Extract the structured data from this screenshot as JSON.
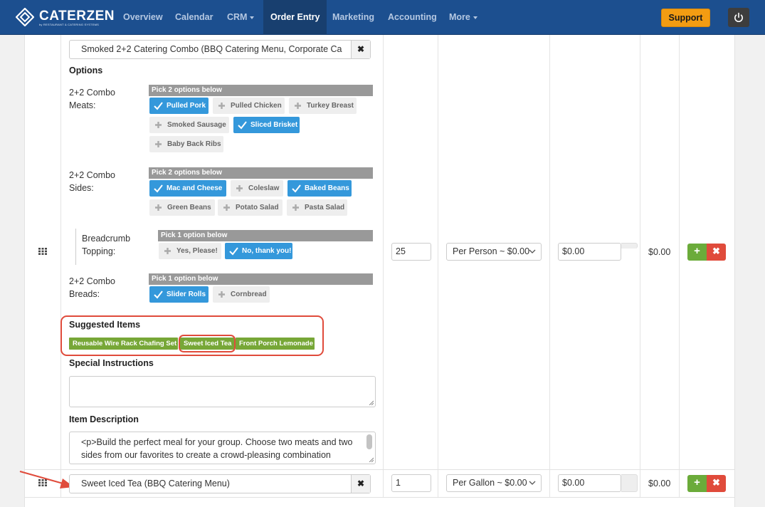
{
  "brand": {
    "name": "CATERZEN",
    "tagline": "by RESTAURANT & CATERING SYSTEMS"
  },
  "nav": {
    "items": [
      {
        "label": "Overview",
        "has_caret": false,
        "active": false
      },
      {
        "label": "Calendar",
        "has_caret": false,
        "active": false
      },
      {
        "label": "CRM",
        "has_caret": true,
        "active": false
      },
      {
        "label": "Order Entry",
        "has_caret": false,
        "active": true
      },
      {
        "label": "Marketing",
        "has_caret": false,
        "active": false
      },
      {
        "label": "Accounting",
        "has_caret": false,
        "active": false
      },
      {
        "label": "More",
        "has_caret": true,
        "active": false
      }
    ],
    "support_label": "Support",
    "power_icon": "power-icon"
  },
  "line1": {
    "item_name": "Smoked 2+2 Catering Combo (BBQ Catering Menu, Corporate Ca",
    "clear_symbol": "✖",
    "options_title": "Options",
    "option_groups": [
      {
        "label": "2+2 Combo Meats:",
        "pick_text": "Pick 2 options below",
        "choices": [
          {
            "label": "Pulled Pork",
            "selected": true
          },
          {
            "label": "Pulled Chicken",
            "selected": false
          },
          {
            "label": "Turkey Breast",
            "selected": false
          },
          {
            "label": "Smoked Sausage",
            "selected": false
          },
          {
            "label": "Sliced Brisket",
            "selected": true
          },
          {
            "label": "Baby Back Ribs",
            "selected": false
          }
        ]
      },
      {
        "label": "2+2 Combo Sides:",
        "pick_text": "Pick 2 options below",
        "choices": [
          {
            "label": "Mac and Cheese",
            "selected": true
          },
          {
            "label": "Coleslaw",
            "selected": false
          },
          {
            "label": "Baked Beans",
            "selected": true
          },
          {
            "label": "Green Beans",
            "selected": false
          },
          {
            "label": "Potato Salad",
            "selected": false
          },
          {
            "label": "Pasta Salad",
            "selected": false
          }
        ]
      },
      {
        "label": "Breadcrumb Topping:",
        "pick_text": "Pick 1 option below",
        "choices": [
          {
            "label": "Yes, Please!",
            "selected": false
          },
          {
            "label": "No, thank you!",
            "selected": true
          }
        ]
      },
      {
        "label": "2+2 Combo Breads:",
        "pick_text": "Pick 1 option below",
        "choices": [
          {
            "label": "Slider Rolls",
            "selected": true
          },
          {
            "label": "Cornbread",
            "selected": false
          }
        ]
      }
    ],
    "suggested_title": "Suggested Items",
    "suggested_items": [
      "Reusable Wire Rack Chafing Set",
      "Sweet Iced Tea",
      "Front Porch Lemonade"
    ],
    "highlighted_suggestion": "Sweet Iced Tea",
    "special_title": "Special Instructions",
    "special_value": "",
    "description_title": "Item Description",
    "description_text": "<p>Build the perfect meal for your group. Choose two meats and two sides from our favorites to create a crowd-pleasing combination",
    "quantity": "25",
    "unit": "Per Person ~ $0.00",
    "price": "$0.00",
    "total": "$0.00",
    "add_symbol": "+",
    "remove_symbol": "✖"
  },
  "line2": {
    "item_name": "Sweet Iced Tea (BBQ Catering Menu)",
    "clear_symbol": "✖",
    "quantity": "1",
    "unit": "Per Gallon ~ $0.00",
    "price": "$0.00",
    "total": "$0.00",
    "add_symbol": "+",
    "remove_symbol": "✖"
  },
  "colors": {
    "navbar": "#1c4f8f",
    "selected_option": "#3498db",
    "suggested_item": "#77a737",
    "highlight": "#e04b3b",
    "support": "#f39c12"
  }
}
